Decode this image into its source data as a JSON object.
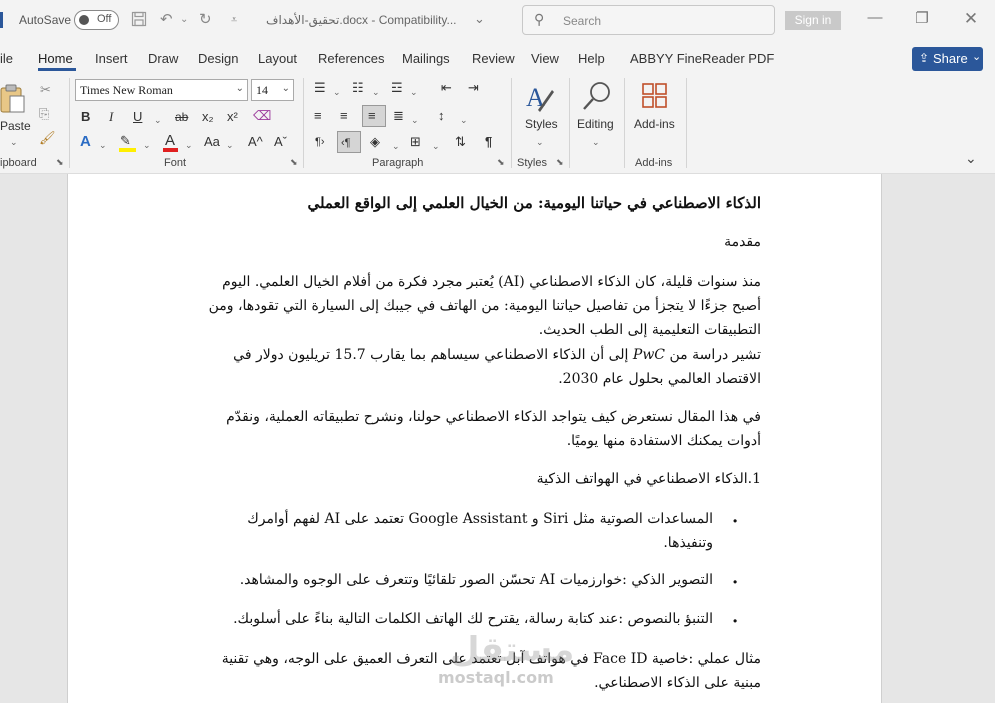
{
  "titlebar": {
    "autosave_label": "AutoSave",
    "autosave_state": "Off",
    "doc_title": "تحقيق-الأهداف.docx - Compatibility...",
    "search_placeholder": "Search",
    "sign_in": "Sign in"
  },
  "tabs": [
    "ile",
    "Home",
    "Insert",
    "Draw",
    "Design",
    "Layout",
    "References",
    "Mailings",
    "Review",
    "View",
    "Help",
    "ABBYY FineReader PDF"
  ],
  "active_tab": "Home",
  "share": {
    "label": "Share"
  },
  "ribbon": {
    "clipboard": {
      "paste_label": "Paste",
      "group_label": "ipboard"
    },
    "font": {
      "font_name": "Times New Roman",
      "font_size": "14",
      "bold": "B",
      "italic": "I",
      "underline": "U",
      "strike": "ab",
      "subscript": "x₂",
      "superscript": "x²",
      "text_effects": "A",
      "font_color": "A",
      "change_case": "Aa",
      "grow": "A^",
      "shrink": "Aˇ",
      "group_label": "Font"
    },
    "paragraph": {
      "group_label": "Paragraph"
    },
    "styles": {
      "label": "Styles",
      "group_label": "Styles"
    },
    "editing": {
      "label": "Editing"
    },
    "addins": {
      "label": "Add-ins",
      "group_label": "Add-ins"
    }
  },
  "document": {
    "title": "الذكاء الاصطناعي في حياتنا اليومية: من الخيال العلمي إلى الواقع العملي",
    "intro_heading": "مقدمة",
    "para1_lines": [
      "منذ سنوات قليلة، كان الذكاء الاصطناعي (AI) يُعتبر مجرد فكرة من أفلام الخيال العلمي. اليوم",
      "أصبح جزءًا لا يتجزأ من تفاصيل حياتنا اليومية: من الهاتف في جيبك إلى السيارة التي تقودها، ومن",
      "التطبيقات التعليمية إلى الطب الحديث."
    ],
    "para2_lines": [
      "تشير دراسة من 𝑃𝑤𝐶 إلى أن الذكاء الاصطناعي سيساهم بما يقارب 15.7 تريليون دولار في",
      "الاقتصاد العالمي بحلول عام 2030."
    ],
    "para3_lines": [
      "في هذا المقال نستعرض كيف يتواجد الذكاء الاصطناعي حولنا، ونشرح تطبيقاته العملية، ونقدّم",
      "أدوات يمكنك الاستفادة منها يوميًا."
    ],
    "section1": "1.الذكاء الاصطناعي في الهواتف الذكية",
    "bullets": [
      {
        "lines": [
          "المساعدات الصوتية مثل Siri و Google Assistant تعتمد على AI لفهم أوامرك",
          "وتنفيذها."
        ]
      },
      {
        "lines": [
          "التصوير الذكي :خوارزميات AI تحسّن الصور تلقائيًا وتتعرف على الوجوه والمشاهد."
        ]
      },
      {
        "lines": [
          "التنبؤ بالنصوص :عند كتابة رسالة، يقترح لك الهاتف الكلمات التالية بناءً على أسلوبك."
        ]
      }
    ],
    "example_lines": [
      "مثال عملي :خاصية Face ID في هواتف آبل تعتمد على التعرف العميق على الوجه، وهي تقنية",
      "مبنية على الذكاء الاصطناعي."
    ]
  },
  "watermark": {
    "logo": "مستقل",
    "text": "mostaql.com"
  }
}
